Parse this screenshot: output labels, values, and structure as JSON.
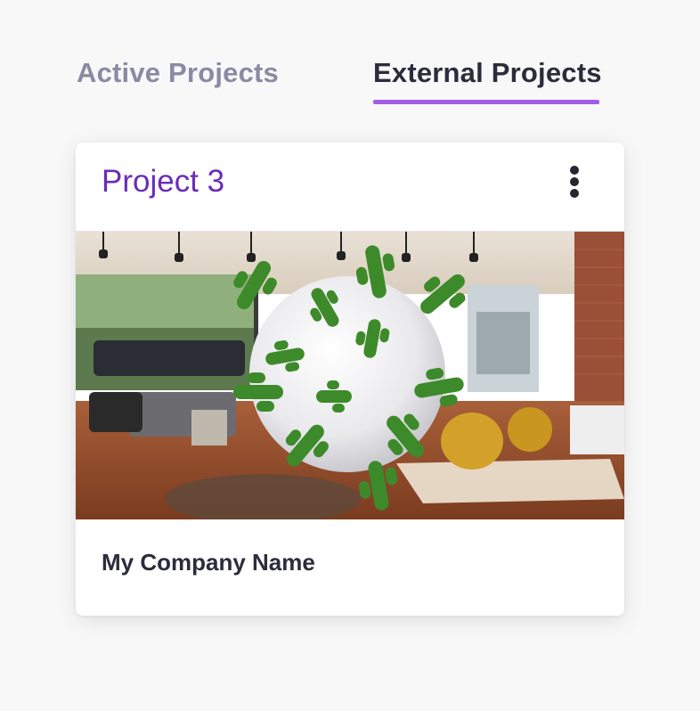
{
  "tabs": [
    {
      "label": "Active Projects",
      "active": false
    },
    {
      "label": "External Projects",
      "active": true
    }
  ],
  "colors": {
    "accent": "#a35be8",
    "title": "#6b2cb6",
    "text_dark": "#2c2c3c",
    "text_muted": "#8a8aa3"
  },
  "card": {
    "title": "Project 3",
    "menu_icon": "kebab-menu-icon",
    "thumbnail_icon": "project-thumbnail-image",
    "subtitle": "My Company Name"
  }
}
